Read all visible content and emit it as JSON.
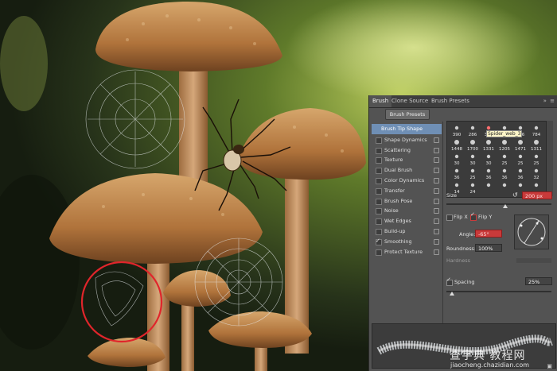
{
  "panel": {
    "tabs": [
      "Brush",
      "Clone Source",
      "Brush Presets"
    ],
    "brush_presets_button": "Brush Presets",
    "list_items": [
      {
        "label": "Brush Tip Shape",
        "checked": null,
        "lock": false
      },
      {
        "label": "Shape Dynamics",
        "checked": false,
        "lock": true
      },
      {
        "label": "Scattering",
        "checked": false,
        "lock": true
      },
      {
        "label": "Texture",
        "checked": false,
        "lock": true
      },
      {
        "label": "Dual Brush",
        "checked": false,
        "lock": true
      },
      {
        "label": "Color Dynamics",
        "checked": false,
        "lock": true
      },
      {
        "label": "Transfer",
        "checked": false,
        "lock": true
      },
      {
        "label": "Brush Pose",
        "checked": false,
        "lock": true
      },
      {
        "label": "Noise",
        "checked": false,
        "lock": true
      },
      {
        "label": "Wet Edges",
        "checked": false,
        "lock": true
      },
      {
        "label": "Build-up",
        "checked": false,
        "lock": true
      },
      {
        "label": "Smoothing",
        "checked": true,
        "lock": true
      },
      {
        "label": "Protect Texture",
        "checked": false,
        "lock": true
      }
    ],
    "brush_grid": {
      "rows": [
        [
          "390",
          "286",
          "351",
          "256",
          "316",
          "784"
        ],
        [
          "1448",
          "1700",
          "1331",
          "1205",
          "1471",
          "1311"
        ],
        [
          "30",
          "30",
          "30",
          "25",
          "25",
          "25"
        ],
        [
          "36",
          "25",
          "36",
          "36",
          "36",
          "32"
        ],
        [
          "14",
          "24",
          "",
          "",
          "",
          ""
        ]
      ],
      "tooltip": "Spider_web_3"
    },
    "size_label": "Size",
    "size_value": "200 px",
    "flip_x_label": "Flip X",
    "flip_y_label": "Flip Y",
    "flip_x": false,
    "flip_y": true,
    "angle_label": "Angle:",
    "angle_value": "-65°",
    "roundness_label": "Roundness:",
    "roundness_value": "100%",
    "hardness_label": "Hardness",
    "spacing_label": "Spacing",
    "spacing_checked": true,
    "spacing_value": "25%",
    "size_slider_fraction": 0.56,
    "spacing_slider_fraction": 0.05
  },
  "watermark": {
    "text": "查字典 教程网",
    "url": "jiaocheng.chazidian.com"
  },
  "colors": {
    "panel_bg": "#535353",
    "highlight_red": "#c93a3a",
    "selected_item": "#6f8fb5",
    "annotation_circle": "#e0252b"
  }
}
